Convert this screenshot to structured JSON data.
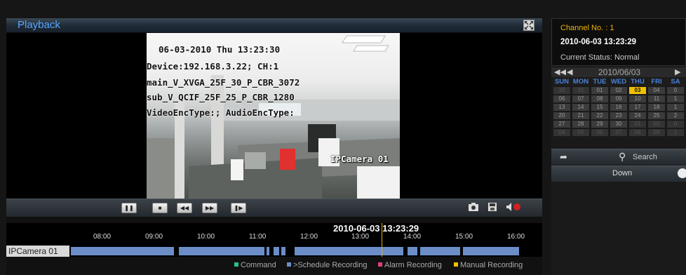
{
  "window": {
    "title": "Playback",
    "fullscreen_icon": "fullscreen-icon"
  },
  "video": {
    "osd_datetime": "06-03-2010  Thu   13:23:30",
    "osd_device": "Device:192.168.3.22; CH:1",
    "osd_main": "main_V_XVGA_25F_30_P_CBR_3072",
    "osd_sub": "sub_V_QCIF_25F_25_P_CBR_1280",
    "osd_enc": "VideoEncType:; AudioEncType:",
    "osd_camera": "IPCamera 01"
  },
  "controls": {
    "buttons": [
      "pause-icon",
      "stop-icon",
      "rewind-icon",
      "fast-forward-icon",
      "step-forward-icon"
    ],
    "icons": [
      "snapshot-icon",
      "save-icon",
      "mute-icon"
    ]
  },
  "timeline": {
    "current_time": "2010-06-03 13:23:29",
    "ticks": [
      "08:00",
      "09:00",
      "10:00",
      "11:00",
      "12:00",
      "13:00",
      "14:00",
      "15:00",
      "16:00"
    ],
    "camera": "IPCamera 01",
    "cursor_color": "#e0b000",
    "recording_color": "#6b8ec9"
  },
  "legend": [
    {
      "label": "Command",
      "color": "#29c08c"
    },
    {
      "label": ">Schedule Recording",
      "color": "#6b8ec9"
    },
    {
      "label": "Alarm Recording",
      "color": "#e0407a"
    },
    {
      "label": "Manual Recording",
      "color": "#f0c000"
    }
  ],
  "channel_info": {
    "channel_no": "Channel No. : 1",
    "datetime": "2010-06-03 13:23:29",
    "status": "Current Status: Normal"
  },
  "calendar": {
    "title": "2010/06/03",
    "weekdays": [
      "SUN",
      "MON",
      "TUE",
      "WED",
      "THU",
      "FRI",
      "SA"
    ],
    "weeks": [
      [
        "30",
        "31",
        "01",
        "02",
        "03",
        "04",
        "0"
      ],
      [
        "06",
        "07",
        "08",
        "09",
        "10",
        "11",
        "1"
      ],
      [
        "13",
        "14",
        "15",
        "16",
        "17",
        "18",
        "1"
      ],
      [
        "20",
        "21",
        "22",
        "23",
        "24",
        "25",
        "2"
      ],
      [
        "27",
        "28",
        "29",
        "30",
        "01",
        "02",
        "0"
      ],
      [
        "04",
        "05",
        "06",
        "07",
        "08",
        "09",
        "1"
      ]
    ],
    "selected": "03"
  },
  "actions": {
    "search": "Search",
    "down": "Down"
  }
}
